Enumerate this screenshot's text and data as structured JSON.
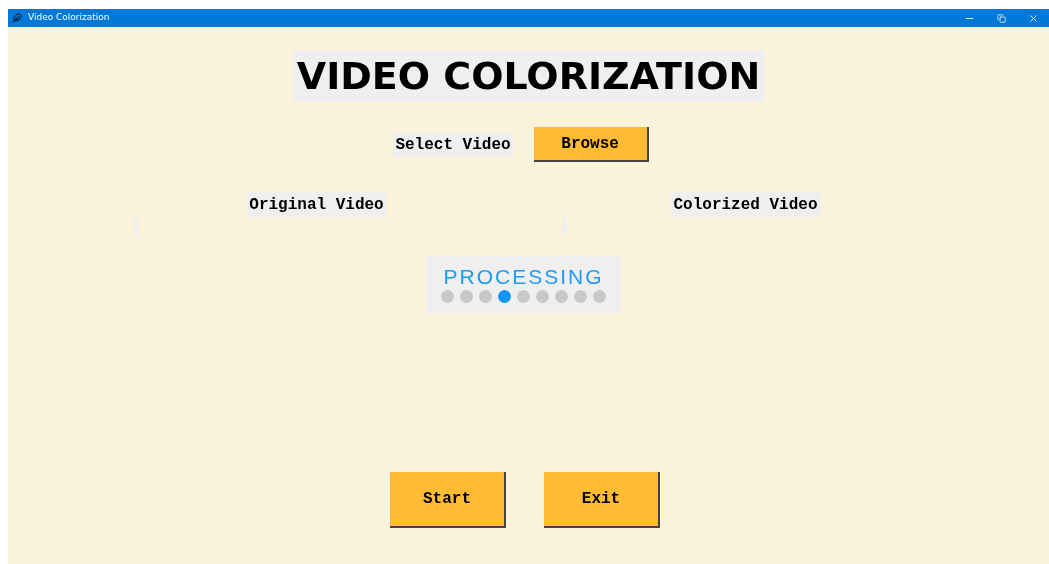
{
  "window": {
    "title": "Video Colorization"
  },
  "heading": "VIDEO COLORIZATION",
  "select": {
    "label": "Select Video",
    "button": "Browse"
  },
  "panels": [
    {
      "label": "Original Video"
    },
    {
      "label": "Colorized Video"
    }
  ],
  "progress": {
    "label": "PROCESSING",
    "dots": [
      {
        "selected": false
      },
      {
        "selected": false
      },
      {
        "selected": false
      },
      {
        "selected": true
      },
      {
        "selected": false
      },
      {
        "selected": false
      },
      {
        "selected": false
      },
      {
        "selected": false
      },
      {
        "selected": false
      }
    ]
  },
  "buttons": [
    "Start",
    "Exit"
  ]
}
